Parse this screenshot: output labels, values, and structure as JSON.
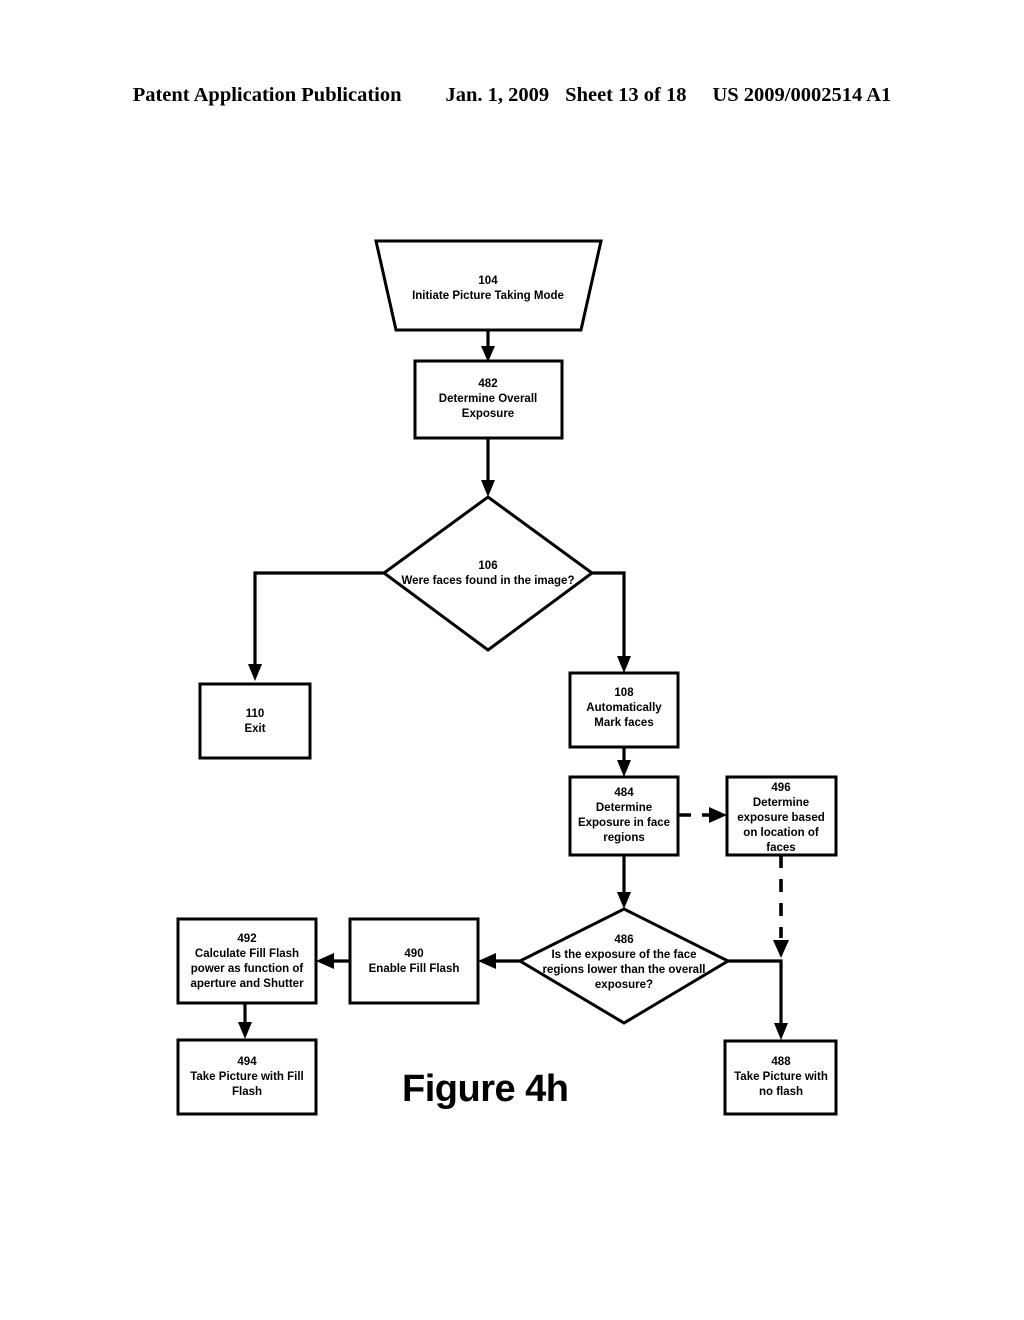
{
  "header": {
    "publication": "Patent Application Publication",
    "date": "Jan. 1, 2009",
    "sheet": "Sheet 13 of 18",
    "patent_number": "US 2009/0002514 A1"
  },
  "figure": {
    "caption": "Figure 4h"
  },
  "nodes": {
    "n104": {
      "ref": "104",
      "text": "Initiate Picture Taking Mode",
      "shape": "trapezoid"
    },
    "n482": {
      "ref": "482",
      "line1": "Determine Overall",
      "line2": "Exposure",
      "shape": "rect"
    },
    "n106": {
      "ref": "106",
      "text": "Were faces found in the image?",
      "shape": "diamond"
    },
    "n110": {
      "ref": "110",
      "text": "Exit",
      "shape": "rect"
    },
    "n108": {
      "ref": "108",
      "line1": "Automatically",
      "line2": "Mark faces",
      "shape": "rect"
    },
    "n484": {
      "ref": "484",
      "line1": "Determine",
      "line2": "Exposure in face",
      "line3": "regions",
      "shape": "rect"
    },
    "n496": {
      "ref": "496",
      "line1": "Determine",
      "line2": "exposure based",
      "line3": "on location of",
      "line4": "faces",
      "shape": "rect"
    },
    "n486": {
      "ref": "486",
      "line1": "Is the exposure of the face",
      "line2": "regions lower than the overall",
      "line3": "exposure?",
      "shape": "diamond"
    },
    "n490": {
      "ref": "490",
      "text": "Enable Fill Flash",
      "shape": "rect"
    },
    "n492": {
      "ref": "492",
      "line1": "Calculate Fill Flash",
      "line2": "power as function of",
      "line3": "aperture and Shutter",
      "shape": "rect"
    },
    "n494": {
      "ref": "494",
      "line1": "Take Picture with Fill",
      "line2": "Flash",
      "shape": "rect"
    },
    "n488": {
      "ref": "488",
      "line1": "Take Picture with",
      "line2": "no flash",
      "shape": "rect"
    }
  },
  "colors": {
    "ink": "#000000",
    "paper": "#ffffff"
  }
}
